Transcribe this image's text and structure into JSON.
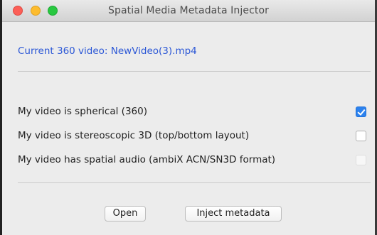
{
  "window": {
    "title": "Spatial Media Metadata Injector"
  },
  "current_video": "Current 360 video: NewVideo(3).mp4",
  "options": [
    {
      "label": "My video is spherical (360)",
      "checked": true
    },
    {
      "label": "My video is stereoscopic 3D (top/bottom layout)",
      "checked": false
    },
    {
      "label": "My video has spatial audio (ambiX ACN/SN3D format)",
      "checked": false
    }
  ],
  "buttons": {
    "open_label": "Open",
    "inject_label": "Inject metadata"
  },
  "colors": {
    "accent_link": "#2b57d6",
    "checkbox_checked": "#2c82ee",
    "close": "#fc5f57",
    "minimize": "#fdbc2e",
    "maximize": "#28c840"
  }
}
